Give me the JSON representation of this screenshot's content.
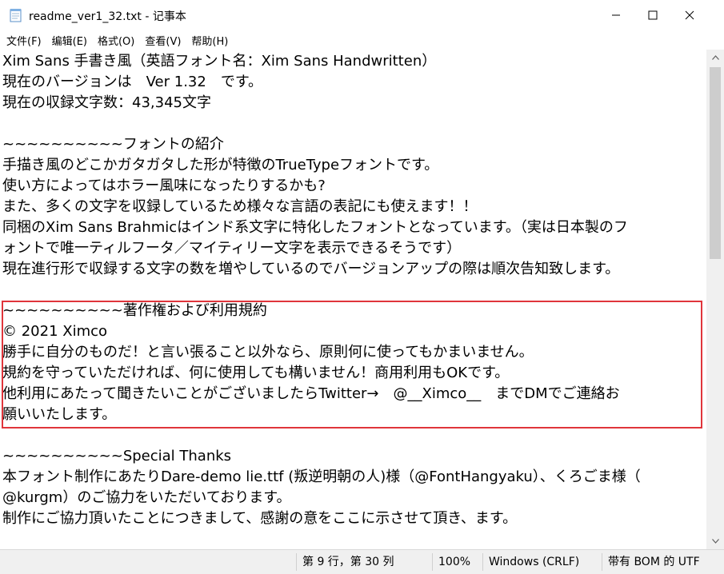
{
  "window": {
    "title": "readme_ver1_32.txt - 记事本"
  },
  "menu": [
    {
      "label": "文件(F)"
    },
    {
      "label": "编辑(E)"
    },
    {
      "label": "格式(O)"
    },
    {
      "label": "查看(V)"
    },
    {
      "label": "帮助(H)"
    }
  ],
  "lines": [
    "Xim Sans 手書き風（英語フォント名：Xim Sans Handwritten）",
    "現在のバージョンは　Ver 1.32　です。",
    "現在の収録文字数：43,345文字",
    "",
    "~~~~~~~~~~フォントの紹介",
    "手描き風のどこかガタガタした形が特徴のTrueTypeフォントです。",
    "使い方によってはホラー風味になったりするかも?",
    "また、多くの文字を収録しているため様々な言語の表記にも使えます！！",
    "同梱のXim Sans Brahmicはインド系文字に特化したフォントとなっています。（実は日本製のフ",
    "ォントで唯一ティルフータ／マイティリー文字を表示できるそうです）",
    "現在進行形で収録する文字の数を増やしているのでバージョンアップの際は順次告知致します。",
    "",
    "~~~~~~~~~~著作権および利用規約",
    "© 2021 Ximco",
    "勝手に自分のものだ！と言い張ること以外なら、原則何に使ってもかまいません。",
    "規約を守っていただければ、何に使用しても構いません！商用利用もOKです。",
    "他利用にあたって聞きたいことがございましたらTwitter→　@__Ximco__　までDMでご連絡お",
    "願いいたします。",
    "",
    "~~~~~~~~~~Special Thanks",
    "本フォント制作にあたりDare-demo lie.ttf (叛逆明朝の人)様（@FontHangyaku）、くろごま様（",
    "@kurgm）のご協力をいただいております。",
    "制作にご協力頂いたことにつきまして、感謝の意をここに示させて頂き、ます。"
  ],
  "status": {
    "position": "第 9 行，第 30 列",
    "zoom": "100%",
    "line_ending": "Windows (CRLF)",
    "encoding": "带有 BOM 的 UTF"
  },
  "colors": {
    "highlight_border": "#e0353b"
  }
}
